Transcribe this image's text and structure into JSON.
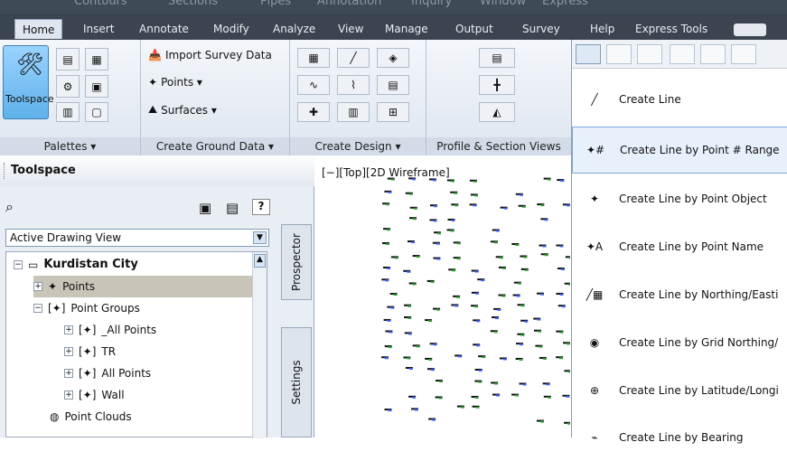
{
  "top_menu": [
    "Contours",
    "Sections",
    "Pipes",
    "Annotation",
    "Inquiry",
    "Window",
    "Express"
  ],
  "tabs": [
    {
      "label": "Home",
      "active": true
    },
    {
      "label": "Insert"
    },
    {
      "label": "Annotate"
    },
    {
      "label": "Modify"
    },
    {
      "label": "Analyze"
    },
    {
      "label": "View"
    },
    {
      "label": "Manage"
    },
    {
      "label": "Output"
    },
    {
      "label": "Survey"
    },
    {
      "label": "Help"
    },
    {
      "label": "Express Tools"
    }
  ],
  "ribbon": {
    "toolspace_label": "Toolspace",
    "palettes_title": "Palettes ▾",
    "import_survey_data": "Import Survey Data",
    "points": "Points ▾",
    "surfaces": "Surfaces ▾",
    "create_ground_title": "Create Ground Data ▾",
    "create_design_title": "Create Design ▾",
    "profile_section_title": "Profile & Section Views"
  },
  "toolspace": {
    "title": "Toolspace",
    "combo_value": "Active Drawing View",
    "prospector_tab": "Prospector",
    "settings_tab": "Settings",
    "tree": [
      {
        "label": "Kurdistan City",
        "bold": true
      },
      {
        "label": "Points",
        "selected": true
      },
      {
        "label": "Point Groups"
      },
      {
        "label": "_All Points"
      },
      {
        "label": "TR"
      },
      {
        "label": "All Points"
      },
      {
        "label": "Wall"
      },
      {
        "label": "Point Clouds"
      }
    ]
  },
  "drawing": {
    "viewport_label": "[−][Top][2D Wireframe]"
  },
  "menu": {
    "items": [
      {
        "label": "Create Line"
      },
      {
        "label": "Create Line by Point # Range",
        "active": true
      },
      {
        "label": "Create Line by Point Object"
      },
      {
        "label": "Create Line by Point Name"
      },
      {
        "label": "Create Line by Northing/Easti"
      },
      {
        "label": "Create Line by Grid Northing/"
      },
      {
        "label": "Create Line by Latitude/Longi"
      },
      {
        "label": "Create Line by Bearing"
      }
    ]
  },
  "colors": {
    "tab_bg": "#3b4551",
    "ribbon_bg": "#dfe6ef",
    "selection": "#c9c4b8",
    "menu_active": "#e7f1fb"
  }
}
